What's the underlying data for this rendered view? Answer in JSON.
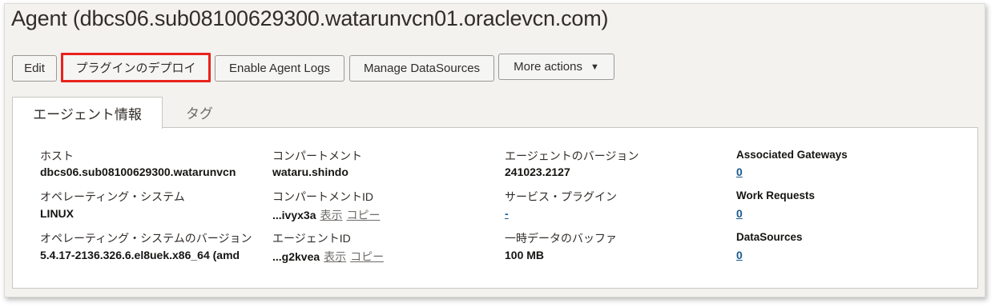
{
  "page": {
    "title": "Agent (dbcs06.sub08100629300.watarunvcn01.oraclevcn.com)"
  },
  "toolbar": {
    "edit": "Edit",
    "deploy_plugin": "プラグインのデプロイ",
    "enable_logs": "Enable Agent Logs",
    "manage_datasources": "Manage DataSources",
    "more_actions": "More actions",
    "more_actions_caret": "▼"
  },
  "tabs": {
    "agent_info": "エージェント情報",
    "tags": "タグ"
  },
  "details": {
    "host_label": "ホスト",
    "host_value": "dbcs06.sub08100629300.watarunvcn",
    "os_label": "オペレーティング・システム",
    "os_value": "LINUX",
    "os_version_label": "オペレーティング・システムのバージョン",
    "os_version_value": "5.4.17-2136.326.6.el8uek.x86_64 (amd",
    "compartment_label": "コンパートメント",
    "compartment_value": "wataru.shindo",
    "compartment_id_label": "コンパートメントID",
    "compartment_id_value": "...ivyx3a",
    "agent_id_label": "エージェントID",
    "agent_id_value": "...g2kvea",
    "show_link": "表示",
    "copy_link": "コピー",
    "agent_version_label": "エージェントのバージョン",
    "agent_version_value": "241023.2127",
    "service_plugins_label": "サービス・プラグイン",
    "service_plugins_value": "-",
    "buffer_label": "一時データのバッファ",
    "buffer_value": "100 MB",
    "associated_gateways_label": "Associated Gateways",
    "associated_gateways_value": "0",
    "work_requests_label": "Work Requests",
    "work_requests_value": "0",
    "datasources_label": "DataSources",
    "datasources_value": "0"
  },
  "colors": {
    "highlight": "#e8231c",
    "link": "#1a5a8e"
  }
}
